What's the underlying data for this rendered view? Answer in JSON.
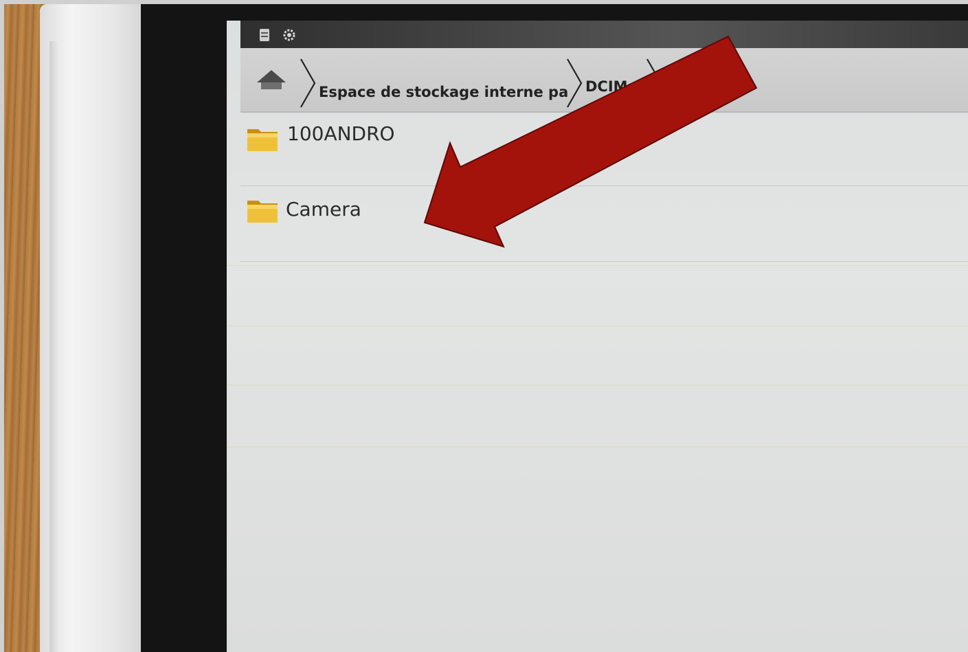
{
  "breadcrumb": {
    "items": [
      {
        "label": "Espace de stockage interne partag"
      },
      {
        "label": "DCIM"
      }
    ]
  },
  "files": [
    {
      "name": "100ANDRO",
      "icon": "folder-icon"
    },
    {
      "name": "Camera",
      "icon": "folder-icon"
    }
  ],
  "colors": {
    "annotation_arrow": "#a4120c",
    "folder": "#e7b21f",
    "status_bar": "#3a3a3a"
  }
}
